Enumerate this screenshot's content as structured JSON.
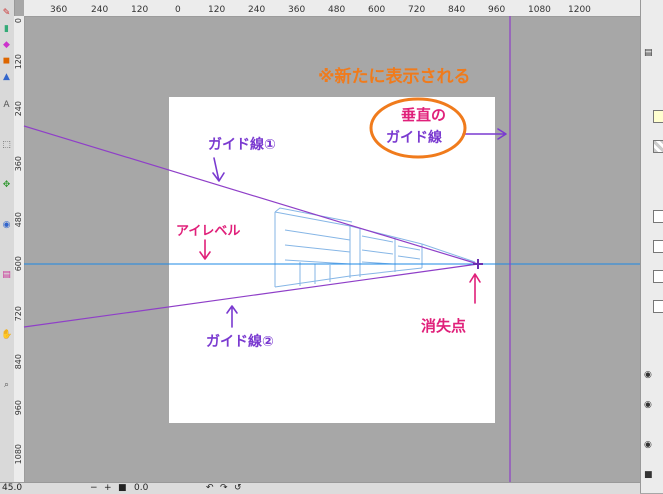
{
  "rulers": {
    "top_ticks": [
      "360",
      "240",
      "120",
      "0",
      "120",
      "240",
      "360",
      "480",
      "600",
      "720",
      "840",
      "960",
      "1080",
      "1200"
    ],
    "left_ticks": [
      "0",
      "120",
      "240",
      "360",
      "480",
      "600",
      "720",
      "840",
      "960",
      "1080"
    ]
  },
  "annotations": {
    "new_display_note": "※新たに表示される",
    "vertical_guide_line1": "垂直の",
    "vertical_guide_line2": "ガイド線",
    "guide_line_1": "ガイド線①",
    "eye_level": "アイレベル",
    "vanishing_point": "消失点",
    "guide_line_2": "ガイド線②"
  },
  "statusbar": {
    "zoom": "45.0",
    "zoom_out": "−",
    "zoom_in": "+",
    "angle": "0.0"
  },
  "colors": {
    "canvas_bg": "#a7a7a7",
    "guide": "#8f3fc8",
    "eye_level": "#1e88e5",
    "annotation_orange": "#f07b1c",
    "annotation_purple": "#7a3ad0",
    "annotation_magenta": "#e0207a",
    "building_sketch": "#86b6e6"
  },
  "icons": {
    "tools": [
      "pen-icon",
      "brush-icon",
      "eraser-icon",
      "fill-icon",
      "gradient-icon",
      "text-icon",
      "select-icon",
      "move-icon",
      "eyedropper-icon",
      "ruler-icon",
      "hand-icon",
      "zoom-icon"
    ],
    "right_panel": [
      "layer-icon",
      "eye-icon",
      "lock-icon"
    ]
  }
}
